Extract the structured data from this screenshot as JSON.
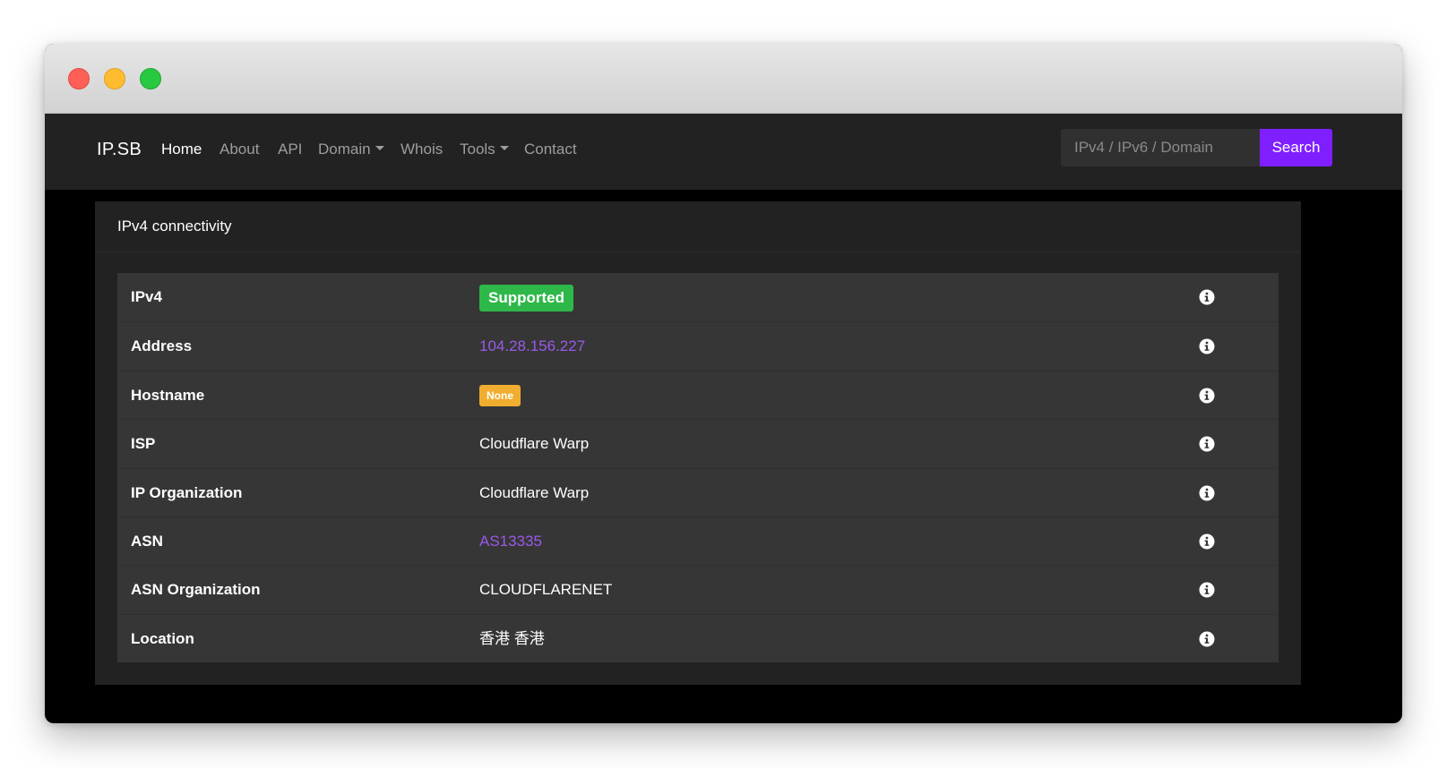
{
  "navbar": {
    "brand": "IP.SB",
    "items": [
      {
        "label": "Home"
      },
      {
        "label": "About"
      },
      {
        "label": "API"
      },
      {
        "label": "Domain"
      },
      {
        "label": "Whois"
      },
      {
        "label": "Tools"
      },
      {
        "label": "Contact"
      }
    ],
    "search": {
      "placeholder": "IPv4 / IPv6 / Domain",
      "button_label": "Search"
    }
  },
  "card": {
    "title": "IPv4 connectivity",
    "rows": [
      {
        "label": "IPv4",
        "value": "Supported",
        "type": "badge-success"
      },
      {
        "label": "Address",
        "value": "104.28.156.227",
        "type": "link"
      },
      {
        "label": "Hostname",
        "value": "None",
        "type": "badge-warning"
      },
      {
        "label": "ISP",
        "value": "Cloudflare Warp",
        "type": "text"
      },
      {
        "label": "IP Organization",
        "value": "Cloudflare Warp",
        "type": "text"
      },
      {
        "label": "ASN",
        "value": "AS13335",
        "type": "link"
      },
      {
        "label": "ASN Organization",
        "value": "CLOUDFLARENET",
        "type": "text"
      },
      {
        "label": "Location",
        "value": "香港 香港",
        "type": "text"
      }
    ]
  },
  "colors": {
    "accent": "#7f1fff",
    "link": "#9b59e8",
    "success": "#2eb84a",
    "warning": "#f0ad2f"
  },
  "icons": {
    "row_info": "info-circle-icon"
  }
}
